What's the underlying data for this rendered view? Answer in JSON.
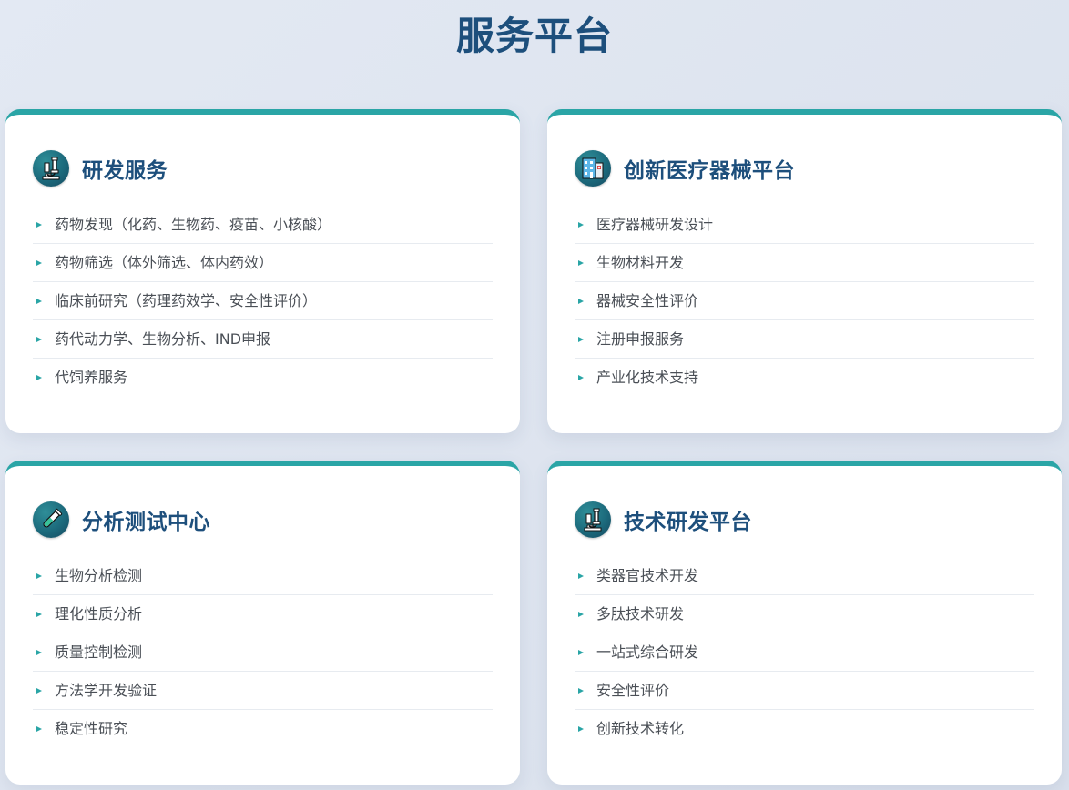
{
  "page": {
    "title": "服务平台"
  },
  "colors": {
    "accent": "#2aa5a6",
    "title": "#1d4f7c",
    "icon_bg": "#1c6a7c"
  },
  "cards": [
    {
      "title": "研发服务",
      "icon": "microscope-icon",
      "items": [
        "药物发现（化药、生物药、疫苗、小核酸）",
        "药物筛选（体外筛选、体内药效）",
        "临床前研究（药理药效学、安全性评价）",
        "药代动力学、生物分析、IND申报",
        "代饲养服务"
      ]
    },
    {
      "title": "创新医疗器械平台",
      "icon": "hospital-building-icon",
      "items": [
        "医疗器械研发设计",
        "生物材料开发",
        "器械安全性评价",
        "注册申报服务",
        "产业化技术支持"
      ]
    },
    {
      "title": "分析测试中心",
      "icon": "test-tube-icon",
      "items": [
        "生物分析检测",
        "理化性质分析",
        "质量控制检测",
        "方法学开发验证",
        "稳定性研究"
      ]
    },
    {
      "title": "技术研发平台",
      "icon": "microscope-icon",
      "items": [
        "类器官技术开发",
        "多肽技术研发",
        "一站式综合研发",
        "安全性评价",
        "创新技术转化"
      ]
    }
  ]
}
